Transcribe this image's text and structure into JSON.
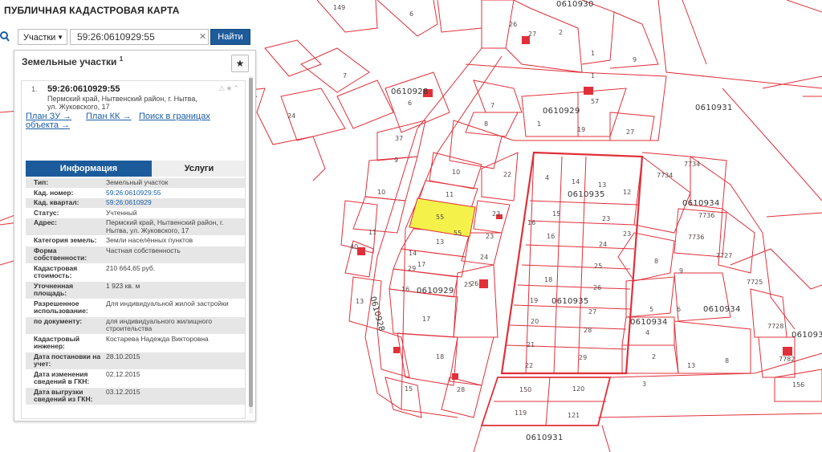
{
  "app": {
    "title": "ПУБЛИЧНАЯ КАДАСТРОВАЯ КАРТА"
  },
  "search": {
    "category": "Участки",
    "value": "59:26:0610929:55",
    "button": "Найти"
  },
  "panel": {
    "title": "Земельные участки",
    "count": "1",
    "item": {
      "index": "1.",
      "cadnum": "59:26:0610929:55",
      "address": "Пермский край, Нытвенский район, г. Нытва, ул. Жуковского, 17",
      "links": [
        "План ЗУ →",
        "План КК →",
        "Поиск в границах",
        "объекта →"
      ],
      "tabs": {
        "info": "Информация",
        "services": "Услуги"
      },
      "attributes": [
        {
          "label": "Тип:",
          "value": "Земельный участок"
        },
        {
          "label": "Кад. номер:",
          "value": "59:26:0610929:55"
        },
        {
          "label": "Кад. квартал:",
          "value": "59:26:0610929"
        },
        {
          "label": "Статус:",
          "value": "Учтенный"
        },
        {
          "label": "Адрес:",
          "value": "Пермский край, Нытвенский район, г. Нытва, ул. Жуковского, 17"
        },
        {
          "label": "Категория земель:",
          "value": "Земли населённых пунктов"
        },
        {
          "label": "Форма собственности:",
          "value": "Частная собственность"
        },
        {
          "label": "Кадастровая стоимость:",
          "value": "210 664,65 руб."
        },
        {
          "label": "Уточненная площадь:",
          "value": "1 923 кв. м"
        },
        {
          "label": "Разрешенное использование:",
          "value": "Для индивидуальной жилой застройки"
        },
        {
          "label": "по документу:",
          "value": "для индивидуального жилищного строительства"
        },
        {
          "label": "Кадастровый инженер:",
          "value": "Костарева Надежда Викторовна"
        },
        {
          "label": "Дата постановки на учет:",
          "value": "28.10.2015"
        },
        {
          "label": "Дата изменения сведений в ГКН:",
          "value": "02.12.2015"
        },
        {
          "label": "Дата выгрузки сведений из ГКН:",
          "value": "03.12.2015"
        }
      ]
    }
  },
  "map": {
    "quarters": [
      "0610930",
      "0610928",
      "0610929",
      "0610931",
      "0610935",
      "0610934",
      "0610929",
      "0610935",
      "0610934",
      "0610934",
      "0610928",
      "0610931",
      "061093"
    ],
    "parcels": [
      "149",
      "6",
      "26",
      "27",
      "2",
      "1",
      "9",
      "7",
      "6",
      "24",
      "57",
      "7",
      "1",
      "19",
      "27",
      "8",
      "37",
      "9",
      "10",
      "22",
      "4",
      "14",
      "13",
      "12",
      "10",
      "11",
      "7734",
      "7734",
      "7736",
      "7736",
      "23",
      "55",
      "55",
      "16",
      "15",
      "23",
      "11",
      "23",
      "13",
      "16",
      "24",
      "7727",
      "24",
      "40",
      "17",
      "25",
      "8",
      "9",
      "14",
      "29",
      "16",
      "25",
      "18",
      "26",
      "7725",
      "13",
      "17",
      "19",
      "27",
      "5",
      "6",
      "7728",
      "20",
      "28",
      "4",
      "13",
      "8",
      "7782",
      "21",
      "29",
      "3",
      "18",
      "22",
      "156",
      "15",
      "28",
      "150",
      "120",
      "119",
      "121",
      "23",
      "26",
      "2",
      "1"
    ]
  },
  "colors": {
    "accent": "#1c5b9b",
    "parcel_line": "#e0303a",
    "highlight": "#f4f24a"
  }
}
